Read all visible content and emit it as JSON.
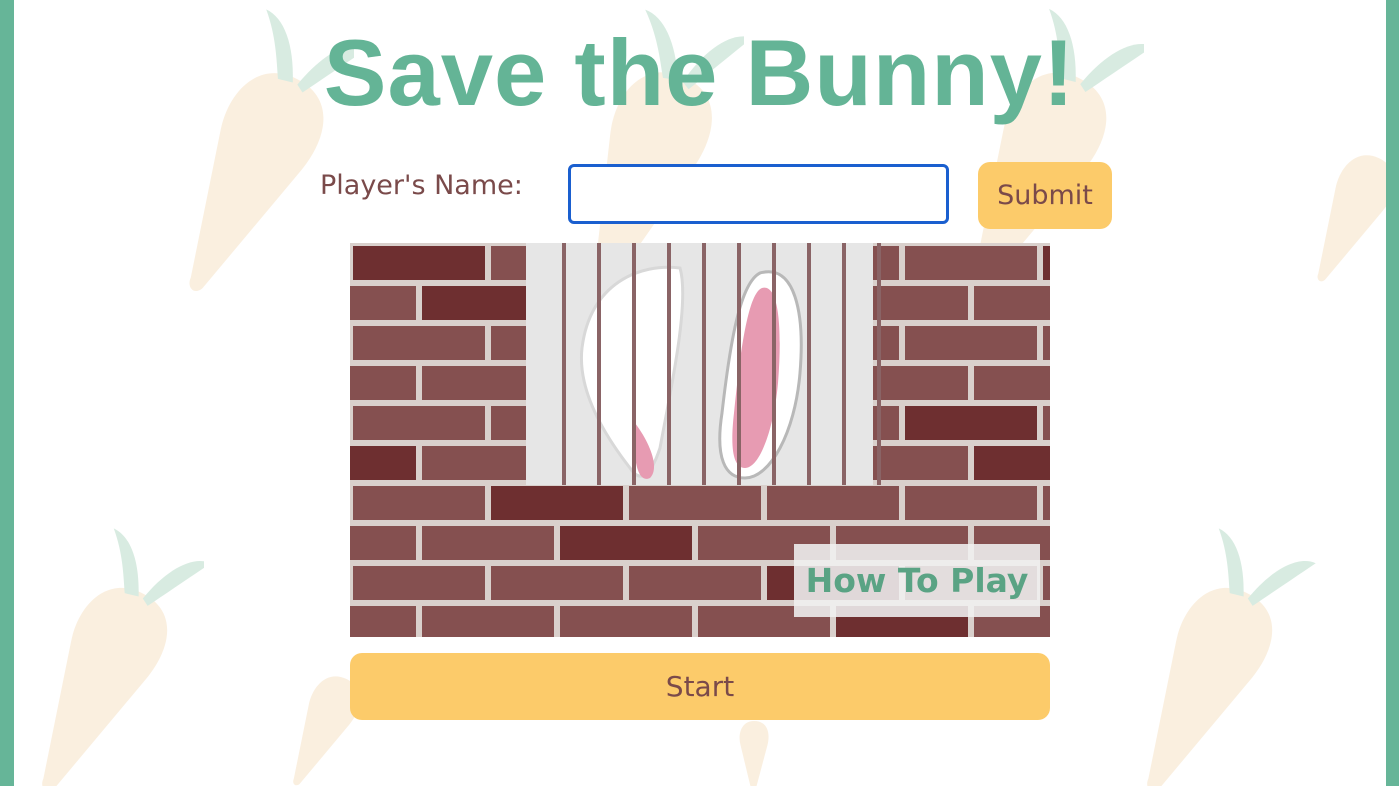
{
  "page": {
    "title": "Save the Bunny!"
  },
  "form": {
    "name_label": "Player's Name:",
    "name_value": "",
    "submit_label": "Submit"
  },
  "scene": {
    "how_to_play_label": "How To Play"
  },
  "controls": {
    "start_label": "Start"
  },
  "colors": {
    "frame": "#66b598",
    "title": "#64b496",
    "button": "#fccb6a",
    "button_text": "#7a4a4a",
    "brick_dark": "#6e2f30",
    "brick_light": "#855050",
    "mortar": "#d9d0cc"
  }
}
